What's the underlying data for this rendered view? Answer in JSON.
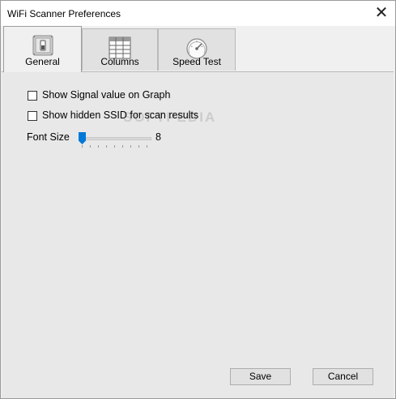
{
  "window": {
    "title": "WiFi Scanner Preferences",
    "close_symbol": "✕"
  },
  "tabs": [
    {
      "label": "General",
      "icon": "toggle-switch-icon",
      "active": true
    },
    {
      "label": "Columns",
      "icon": "table-grid-icon",
      "active": false
    },
    {
      "label": "Speed Test",
      "icon": "speedometer-icon",
      "active": false
    }
  ],
  "general": {
    "show_signal_value": {
      "label": "Show Signal value on Graph",
      "checked": false
    },
    "show_hidden_ssid": {
      "label": "Show hidden SSID for scan results",
      "checked": false
    },
    "font_size": {
      "label": "Font Size",
      "value": "8"
    }
  },
  "watermark": "SOFTPEDIA",
  "buttons": {
    "save": "Save",
    "cancel": "Cancel"
  },
  "colors": {
    "accent": "#0078d7",
    "panel": "#e8e8e8",
    "tab_inactive": "#e1e1e1"
  }
}
